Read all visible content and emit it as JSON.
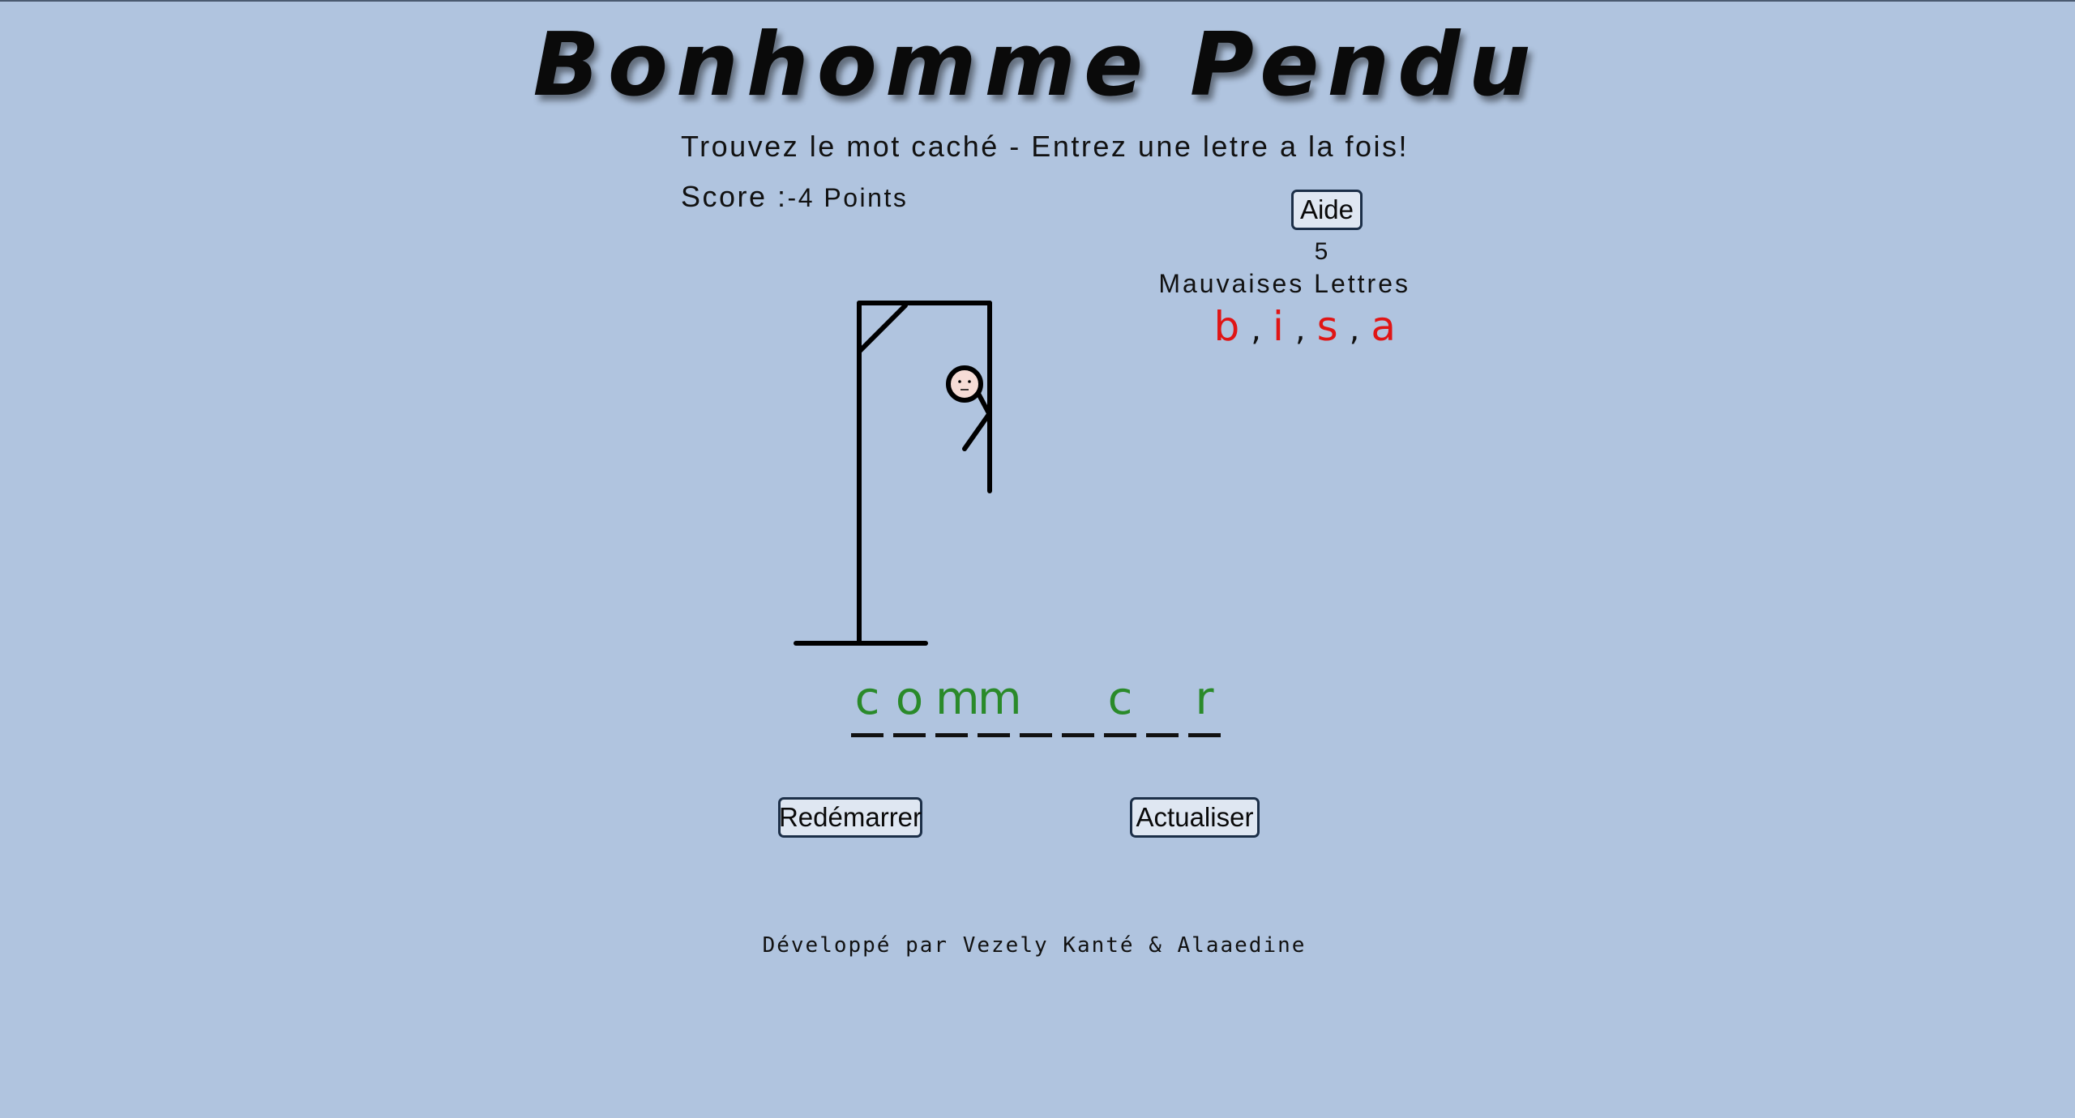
{
  "game": {
    "title": "Bonhomme Pendu",
    "subtitle": "Trouvez le mot caché - Entrez une letre a la fois!",
    "score_label": "Score :",
    "score_value": "-4 Points",
    "help_label": "Aide",
    "wrong_count": "5",
    "wrong_label": "Mauvaises Lettres",
    "wrong_letters": [
      "b",
      "i",
      "s",
      "a"
    ],
    "word_slots": [
      "c",
      "o",
      "m",
      "m",
      "",
      "",
      "c",
      "",
      "r"
    ],
    "restart_label": "Redémarrer",
    "refresh_label": "Actualiser",
    "footer": "Développé par Vezely Kanté & Alaaedine"
  },
  "colors": {
    "background": "#b0c4df",
    "correct_letter": "#2a8a2a",
    "wrong_letter": "#e01515"
  }
}
